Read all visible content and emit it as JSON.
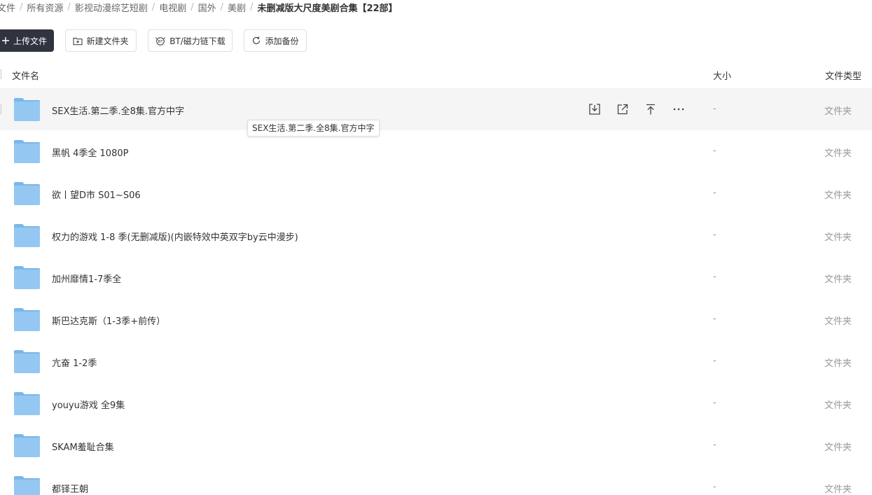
{
  "breadcrumb": {
    "items": [
      "文件",
      "所有资源",
      "影视动漫综艺短剧",
      "电视剧",
      "国外",
      "美剧"
    ],
    "current": "未删减版大尺度美剧合集【22部】"
  },
  "toolbar": {
    "upload_label": "上传文件",
    "new_folder_label": "新建文件夹",
    "bt_label": "BT/磁力链下载",
    "backup_label": "添加备份"
  },
  "header": {
    "name": "文件名",
    "size": "大小",
    "type": "文件类型"
  },
  "files": [
    {
      "name": "SEX生活.第二季.全8集.官方中字",
      "size": "-",
      "type": "文件夹"
    },
    {
      "name": "黑帆 4季全 1080P",
      "size": "-",
      "type": "文件夹"
    },
    {
      "name": "欲丨望D市 S01~S06",
      "size": "-",
      "type": "文件夹"
    },
    {
      "name": "权力的游戏 1-8 季(无删减版)(内嵌特效中英双字by云中漫步)",
      "size": "-",
      "type": "文件夹"
    },
    {
      "name": "加州靡情1-7季全",
      "size": "-",
      "type": "文件夹"
    },
    {
      "name": "斯巴达克斯（1-3季+前传）",
      "size": "-",
      "type": "文件夹"
    },
    {
      "name": "亢奋 1-2季",
      "size": "-",
      "type": "文件夹"
    },
    {
      "name": "youyu游戏  全9集",
      "size": "-",
      "type": "文件夹"
    },
    {
      "name": "SKAM羞耻合集",
      "size": "-",
      "type": "文件夹"
    },
    {
      "name": "都铎王朝",
      "size": "-",
      "type": "文件夹"
    }
  ],
  "tooltip": "SEX生活.第二季.全8集.官方中字",
  "colors": {
    "upload_bg": "#31343f",
    "folder": "#7ab7ea",
    "hover_row": "#f5f5f6",
    "muted_text": "#999999"
  }
}
